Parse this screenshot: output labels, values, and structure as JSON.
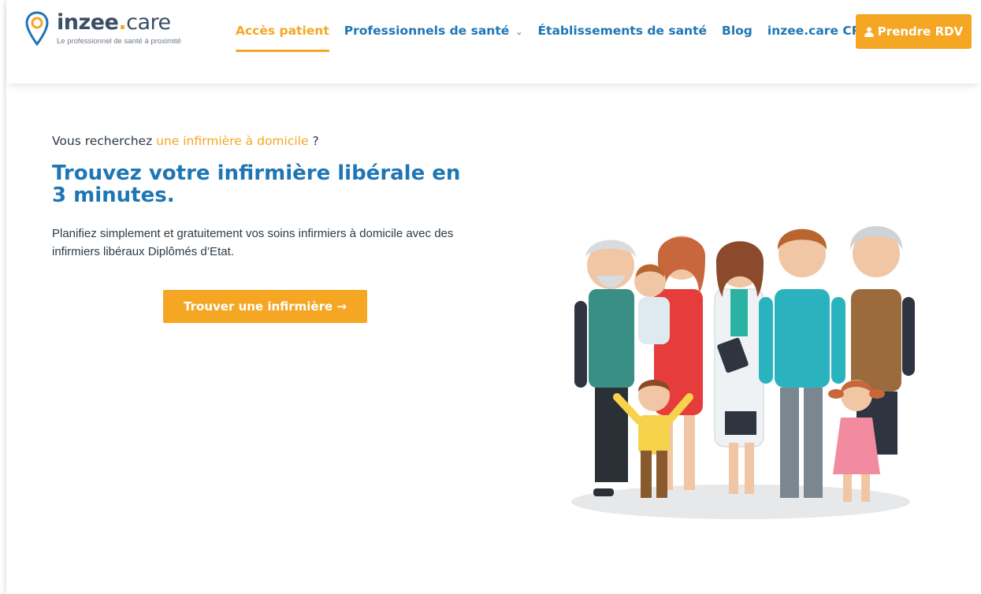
{
  "brand": {
    "name_main": "inzee",
    "name_dot": ".",
    "name_suffix": "care",
    "tagline": "Le professionnel de santé à proximité",
    "accent_color": "#f5a623",
    "primary_color": "#1f76b5"
  },
  "nav": {
    "items": [
      {
        "label": "Accès patient",
        "active": true
      },
      {
        "label": "Professionnels de santé",
        "has_dropdown": true
      },
      {
        "label": "Établissements de santé"
      },
      {
        "label": "Blog"
      },
      {
        "label": "inzee.care CPTS"
      }
    ],
    "cta_label": "Prendre RDV",
    "cta_icon": "user-icon"
  },
  "hero": {
    "kicker_prefix": "Vous recherchez ",
    "kicker_highlight": "une infirmière à domicile",
    "kicker_suffix": " ?",
    "title": "Trouvez votre infirmière libérale en 3 minutes.",
    "description": "Planifiez simplement et gratuitement vos soins infirmiers à domicile avec des infirmiers libéraux Diplômés d’Etat.",
    "cta_label": "Trouver une infirmière →"
  }
}
